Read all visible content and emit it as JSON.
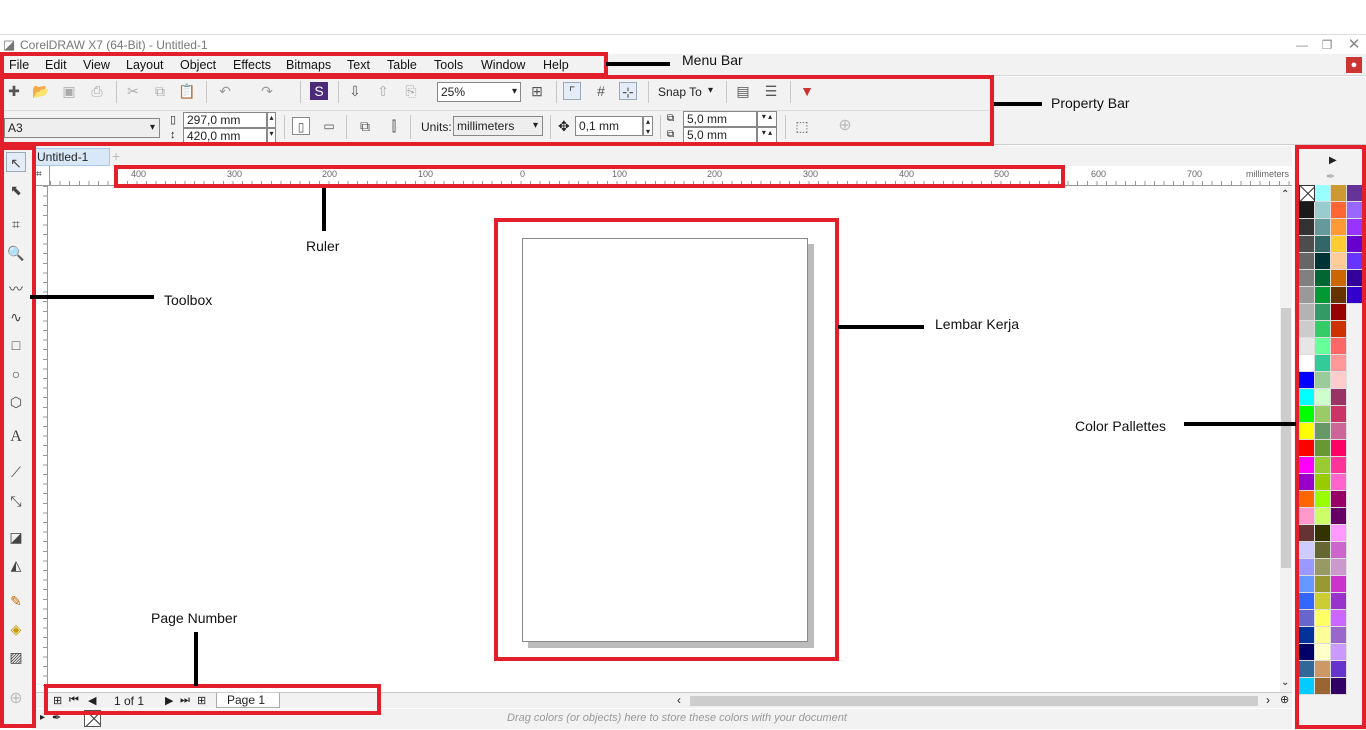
{
  "window": {
    "title": "CorelDRAW X7 (64-Bit) - Untitled-1"
  },
  "menu": [
    "File",
    "Edit",
    "View",
    "Layout",
    "Object",
    "Effects",
    "Bitmaps",
    "Text",
    "Table",
    "Tools",
    "Window",
    "Help"
  ],
  "property_bar": {
    "zoom": "25%",
    "snap_to": "Snap To",
    "paper_size": "A3",
    "width": "297,0 mm",
    "height": "420,0 mm",
    "units_label": "Units:",
    "units_value": "millimeters",
    "nudge": "0,1 mm",
    "dup_x": "5,0 mm",
    "dup_y": "5,0 mm"
  },
  "document_tab": "Untitled-1",
  "ruler": {
    "ticks": [
      "400",
      "300",
      "200",
      "100",
      "0",
      "100",
      "200",
      "300",
      "400",
      "500",
      "600",
      "700"
    ],
    "unit": "millimeters"
  },
  "page_nav": {
    "counter": "1 of 1",
    "page_tab": "Page 1"
  },
  "status_hint": "Drag colors (or objects) here to store these colors with your document",
  "annotations": {
    "menu_bar": "Menu Bar",
    "property_bar": "Property Bar",
    "ruler": "Ruler",
    "toolbox": "Toolbox",
    "workspace": "Lembar Kerja",
    "palettes": "Color Pallettes",
    "page_number": "Page Number"
  },
  "colors": {
    "annotation_red": "#e21f2b",
    "palette": [
      [
        "#000000",
        "#1a1a1a",
        "#333333",
        "#4d4d4d",
        "#666666",
        "#808080",
        "#999999",
        "#b3b3b3",
        "#cccccc",
        "#e6e6e6",
        "#ffffff",
        "#0000ff",
        "#00ffff",
        "#00ff00",
        "#ffff00",
        "#ff0000",
        "#ff00ff",
        "#9900cc",
        "#ff6600",
        "#ff99cc",
        "#663333",
        "#ccccff",
        "#9999ff",
        "#6699ff",
        "#3366ff",
        "#6666cc",
        "#003399",
        "#000066",
        "#336699",
        "#00ccff"
      ],
      [
        "#99ffff",
        "#99cccc",
        "#669999",
        "#336666",
        "#003333",
        "#006633",
        "#009933",
        "#339966",
        "#33cc66",
        "#66ff99",
        "#33cc99",
        "#99cc99",
        "#ccffcc",
        "#99cc66",
        "#669966",
        "#669933",
        "#99cc33",
        "#99cc00",
        "#99ff00",
        "#ccff66",
        "#333300",
        "#666633",
        "#999966",
        "#999933",
        "#cccc33",
        "#ffff66",
        "#ffff99",
        "#ffffcc",
        "#cc9966",
        "#996633"
      ],
      [
        "#cc9933",
        "#ff6633",
        "#ff9933",
        "#ffcc33",
        "#ffcc99",
        "#cc6600",
        "#663300",
        "#990000",
        "#cc3300",
        "#ff6666",
        "#ff9999",
        "#ffcccc",
        "#993366",
        "#cc3366",
        "#cc6699",
        "#ff0066",
        "#ff3399",
        "#ff66cc",
        "#990066",
        "#660066",
        "#ff99ff",
        "#cc66cc",
        "#cc99cc",
        "#cc33cc",
        "#9933cc",
        "#cc66ff",
        "#9966cc",
        "#cc99ff",
        "#6633cc",
        "#330066"
      ],
      [
        "#663399",
        "#9966ff",
        "#9933ff",
        "#6600cc",
        "#6633ff",
        "#330099",
        "#3300cc"
      ]
    ]
  }
}
